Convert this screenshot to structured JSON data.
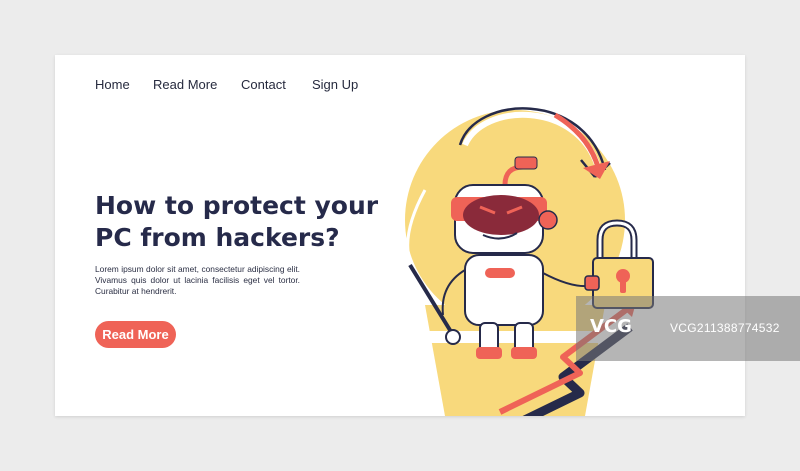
{
  "nav": {
    "items": [
      {
        "label": "Home"
      },
      {
        "label": "Read More"
      },
      {
        "label": "Contact"
      },
      {
        "label": "Sign Up"
      }
    ]
  },
  "hero": {
    "headline": "How to protect your PC from hackers?",
    "body": "Lorem ipsum dolor sit amet, consectetur adipiscing elit. Vivamus quis dolor ut lacinia facilisis eget vel tortor. Curabitur at hendrerit.",
    "cta_label": "Read More"
  },
  "illustration": {
    "icons": [
      "robot-hacker-icon",
      "padlock-icon",
      "curved-arrow-icon",
      "trend-arrow-icon",
      "map-pin-icon"
    ]
  },
  "colors": {
    "accent": "#ef6357",
    "navy": "#262a4a",
    "yellow": "#f8d97c",
    "mask": "#8a2a3a",
    "background": "#ececec"
  },
  "watermark": {
    "logo": "VCG",
    "id": "VCG21138877453​2"
  }
}
